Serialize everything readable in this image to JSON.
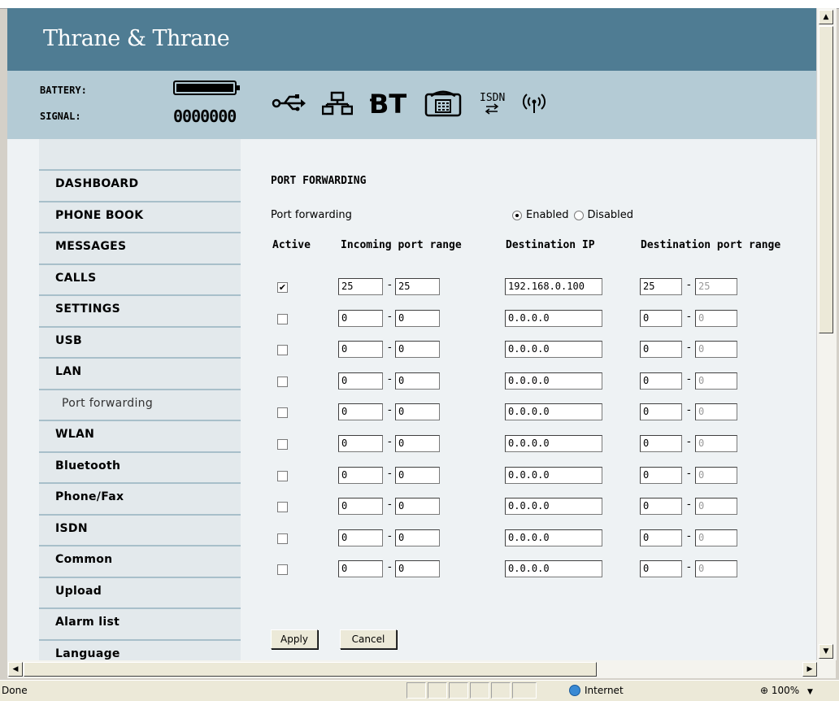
{
  "header": {
    "logo": "Thrane & Thrane"
  },
  "status": {
    "battery_label": "BATTERY:",
    "signal_label": "SIGNAL:",
    "signal_bars": "0000000",
    "isdn_text": "ISDN",
    "interface_icons": [
      "usb-icon",
      "lan-icon",
      "bluetooth-icon",
      "phone-fax-icon",
      "isdn-icon",
      "wlan-icon"
    ]
  },
  "sidebar": {
    "items": [
      {
        "label": "DASHBOARD",
        "level": 0
      },
      {
        "label": "PHONE BOOK",
        "level": 0
      },
      {
        "label": "MESSAGES",
        "level": 0
      },
      {
        "label": "CALLS",
        "level": 0
      },
      {
        "label": "SETTINGS",
        "level": 0
      },
      {
        "label": "USB",
        "level": 1
      },
      {
        "label": "LAN",
        "level": 1
      },
      {
        "label": "Port forwarding",
        "level": 2
      },
      {
        "label": "WLAN",
        "level": 1
      },
      {
        "label": "Bluetooth",
        "level": 1
      },
      {
        "label": "Phone/Fax",
        "level": 1
      },
      {
        "label": "ISDN",
        "level": 1
      },
      {
        "label": "Common",
        "level": 1
      },
      {
        "label": "Upload",
        "level": 1
      },
      {
        "label": "Alarm list",
        "level": 1
      },
      {
        "label": "Language",
        "level": 1
      }
    ]
  },
  "form": {
    "title": "PORT FORWARDING",
    "pf_label": "Port forwarding",
    "enabled_label": "Enabled",
    "disabled_label": "Disabled",
    "enabled_selected": true,
    "headers": {
      "active": "Active",
      "incoming": "Incoming port range",
      "dest_ip": "Destination IP",
      "dest_port": "Destination port range"
    },
    "rows": [
      {
        "active": true,
        "in_from": "25",
        "in_to": "25",
        "ip": "192.168.0.100",
        "out_from": "25",
        "out_to": "25"
      },
      {
        "active": false,
        "in_from": "0",
        "in_to": "0",
        "ip": "0.0.0.0",
        "out_from": "0",
        "out_to": "0"
      },
      {
        "active": false,
        "in_from": "0",
        "in_to": "0",
        "ip": "0.0.0.0",
        "out_from": "0",
        "out_to": "0"
      },
      {
        "active": false,
        "in_from": "0",
        "in_to": "0",
        "ip": "0.0.0.0",
        "out_from": "0",
        "out_to": "0"
      },
      {
        "active": false,
        "in_from": "0",
        "in_to": "0",
        "ip": "0.0.0.0",
        "out_from": "0",
        "out_to": "0"
      },
      {
        "active": false,
        "in_from": "0",
        "in_to": "0",
        "ip": "0.0.0.0",
        "out_from": "0",
        "out_to": "0"
      },
      {
        "active": false,
        "in_from": "0",
        "in_to": "0",
        "ip": "0.0.0.0",
        "out_from": "0",
        "out_to": "0"
      },
      {
        "active": false,
        "in_from": "0",
        "in_to": "0",
        "ip": "0.0.0.0",
        "out_from": "0",
        "out_to": "0"
      },
      {
        "active": false,
        "in_from": "0",
        "in_to": "0",
        "ip": "0.0.0.0",
        "out_from": "0",
        "out_to": "0"
      },
      {
        "active": false,
        "in_from": "0",
        "in_to": "0",
        "ip": "0.0.0.0",
        "out_from": "0",
        "out_to": "0"
      }
    ],
    "dash": "-",
    "apply_label": "Apply",
    "cancel_label": "Cancel"
  },
  "browser_status": {
    "left_text": "Done",
    "zone_text": "Internet",
    "zoom_text": "100%"
  }
}
